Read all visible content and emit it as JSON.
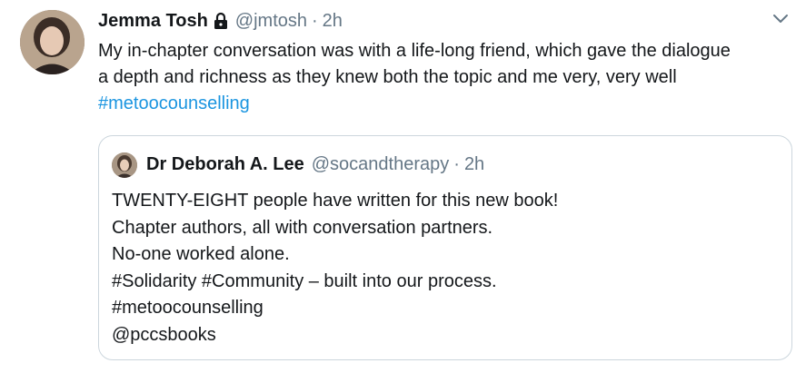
{
  "tweet": {
    "author_name": "Jemma Tosh",
    "lock_icon": "lock-icon",
    "handle": "@jmtosh",
    "separator": "·",
    "time": "2h",
    "menu_icon": "chevron-down-icon",
    "text_lines": [
      "My in-chapter conversation was with a life-long friend, which gave the dialogue",
      "a depth and richness as they knew both the topic and me very, very well"
    ],
    "hashtag": "#metoocounselling"
  },
  "quoted": {
    "author_name": "Dr Deborah A. Lee",
    "handle": "@socandtherapy",
    "separator": "·",
    "time": "2h",
    "text_lines": [
      "TWENTY-EIGHT people have written for this new book!",
      "Chapter authors, all with conversation partners.",
      "No-one worked alone.",
      "#Solidarity #Community – built into our process.",
      "#metoocounselling",
      "@pccsbooks"
    ]
  },
  "colors": {
    "text": "#14171a",
    "secondary": "#657786",
    "link": "#1b95e0",
    "border": "#ccd6dd"
  }
}
